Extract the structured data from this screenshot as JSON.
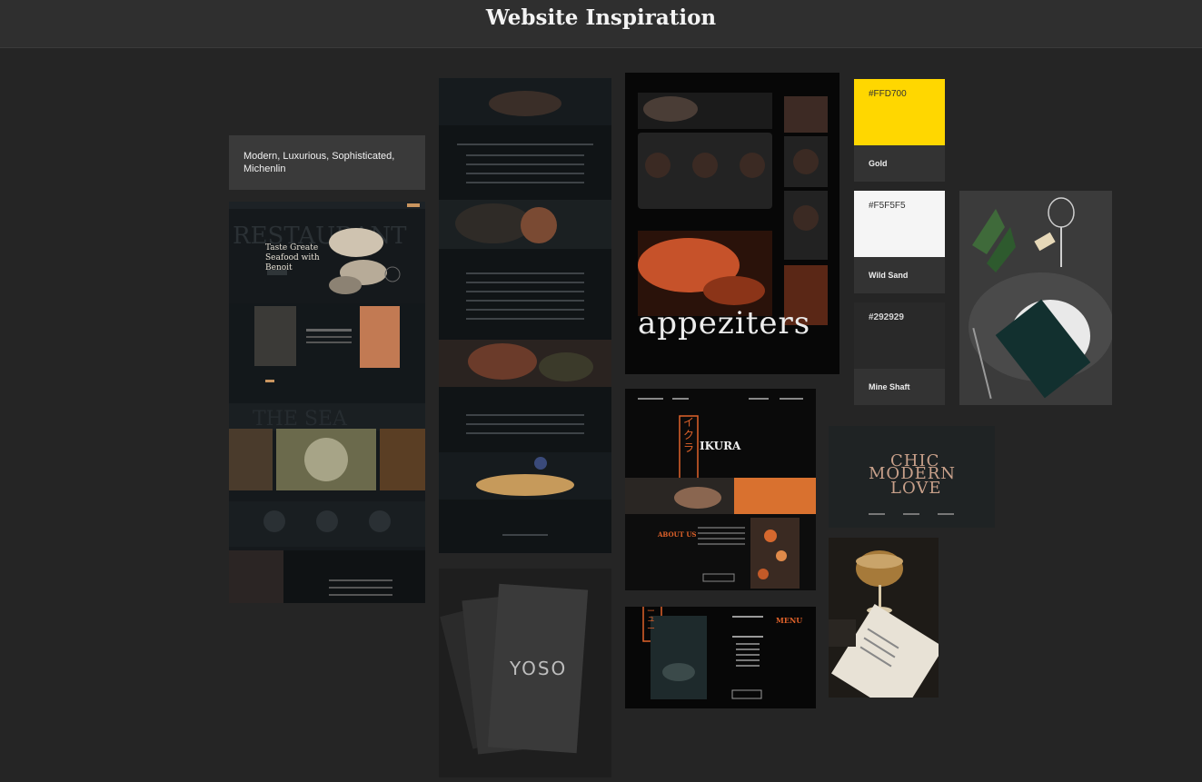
{
  "header": {
    "title": "Website Inspiration"
  },
  "moodboard": {
    "keywords": "Modern, Luxurious, Sophisticated, Michenlin"
  },
  "palette": [
    {
      "hex": "#FFD700",
      "name": "Gold",
      "color": "#FFD700",
      "text_color": "#333333"
    },
    {
      "hex": "#F5F5F5",
      "name": "Wild Sand",
      "color": "#F5F5F5",
      "text_color": "#333333"
    },
    {
      "hex": "#292929",
      "name": "Mine Shaft",
      "color": "#292929",
      "text_color": "#d6d6d6"
    }
  ],
  "shots": {
    "seafood": {
      "hero": "Taste Greate Seafood with Benoit"
    },
    "appetizers": {
      "heading": "appeziters"
    },
    "ikura": {
      "brand": "IKURA",
      "kana": "イクラ",
      "about": "ABOUT US",
      "menu": "MENU",
      "kana2": "メニュー"
    },
    "yoso": {
      "brand": "YOSO"
    },
    "chic": {
      "l1": "CHIC",
      "l2": "MODERN",
      "l3": "LOVE"
    }
  }
}
